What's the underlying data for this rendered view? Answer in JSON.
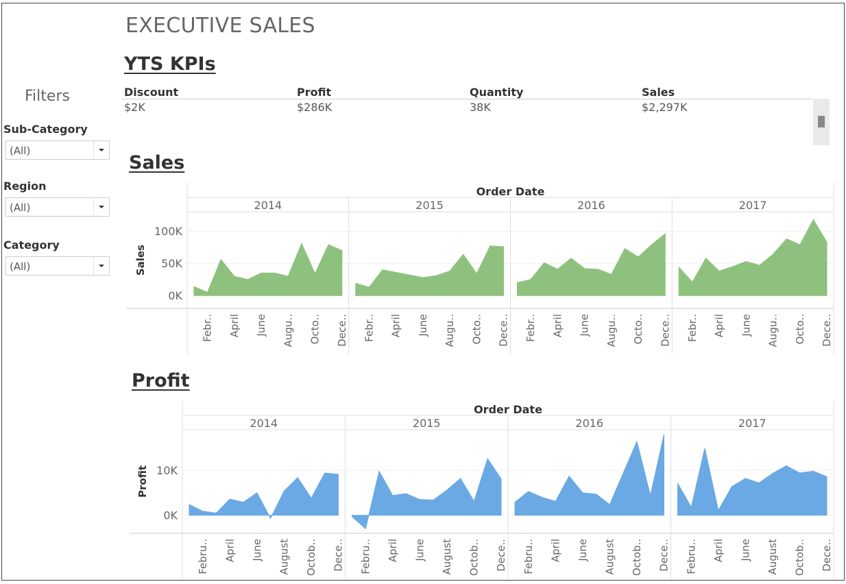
{
  "dashboard": {
    "title": "EXECUTIVE SALES"
  },
  "kpi_section": {
    "title": "YTS KPIs",
    "items": [
      {
        "label": "Discount",
        "value": "$2K"
      },
      {
        "label": "Profit",
        "value": "$286K"
      },
      {
        "label": "Quantity",
        "value": "38K"
      },
      {
        "label": "Sales",
        "value": "$2,297K"
      }
    ]
  },
  "filters": {
    "heading": "Filters",
    "items": [
      {
        "label": "Sub-Category",
        "value": "(All)"
      },
      {
        "label": "Region",
        "value": "(All)"
      },
      {
        "label": "Category",
        "value": "(All)"
      }
    ]
  },
  "colors": {
    "sales": "#8fc17e",
    "profit": "#6aa9e4"
  },
  "chart_data": [
    {
      "type": "area",
      "title": "Sales",
      "column_header": "Order Date",
      "ylabel": "Sales",
      "ylim": [
        -20000,
        130000
      ],
      "yticks": [
        0,
        50000,
        100000
      ],
      "ytick_labels": [
        "0K",
        "50K",
        "100K"
      ],
      "panels": [
        {
          "year": "2014",
          "x_labels": [
            "Febr..",
            "April",
            "June",
            "Augu..",
            "Octo..",
            "Dece.."
          ],
          "values": [
            14000,
            5000,
            56000,
            30000,
            25000,
            35000,
            35000,
            30000,
            81000,
            34000,
            79000,
            70000
          ]
        },
        {
          "year": "2015",
          "x_labels": [
            "Febr..",
            "April",
            "June",
            "Augu..",
            "Octo..",
            "Dece.."
          ],
          "values": [
            19000,
            13000,
            40000,
            36000,
            32000,
            28000,
            31000,
            38000,
            64000,
            34000,
            77000,
            76000
          ]
        },
        {
          "year": "2016",
          "x_labels": [
            "Febr..",
            "April",
            "June",
            "Augu..",
            "Octo..",
            "Dece.."
          ],
          "values": [
            20000,
            25000,
            51000,
            41000,
            58000,
            42000,
            41000,
            33000,
            73000,
            60000,
            79000,
            96000
          ]
        },
        {
          "year": "2017",
          "x_labels": [
            "Febr..",
            "April",
            "June",
            "Augu..",
            "Octo..",
            "Dece.."
          ],
          "values": [
            44000,
            21000,
            58000,
            38000,
            45000,
            53000,
            47000,
            64000,
            88000,
            79000,
            118000,
            83000
          ]
        }
      ]
    },
    {
      "type": "area",
      "title": "Profit",
      "column_header": "Order Date",
      "ylabel": "Profit",
      "ylim": [
        -4000,
        19000
      ],
      "yticks": [
        0,
        10000
      ],
      "ytick_labels": [
        "0K",
        "10K"
      ],
      "panels": [
        {
          "year": "2014",
          "x_labels": [
            "Febru..",
            "April",
            "June",
            "August",
            "Octob..",
            "Dece.."
          ],
          "values": [
            2400,
            900,
            500,
            3600,
            2900,
            5000,
            -700,
            5400,
            8400,
            3800,
            9400,
            9100
          ]
        },
        {
          "year": "2015",
          "x_labels": [
            "Febru..",
            "April",
            "June",
            "August",
            "Octob..",
            "Dece.."
          ],
          "values": [
            -300,
            -3000,
            9800,
            4400,
            4800,
            3500,
            3400,
            5600,
            8200,
            3100,
            12600,
            8100
          ]
        },
        {
          "year": "2016",
          "x_labels": [
            "Febru..",
            "April",
            "June",
            "August",
            "Octob..",
            "Dece.."
          ],
          "values": [
            2900,
            5300,
            4000,
            3100,
            8700,
            5000,
            4700,
            2400,
            9400,
            16400,
            4400,
            18000
          ]
        },
        {
          "year": "2017",
          "x_labels": [
            "Febru..",
            "April",
            "June",
            "August",
            "Octob..",
            "Dece.."
          ],
          "values": [
            7100,
            1800,
            14900,
            1100,
            6400,
            8200,
            7200,
            9300,
            11000,
            9400,
            9800,
            8600
          ]
        }
      ]
    }
  ]
}
